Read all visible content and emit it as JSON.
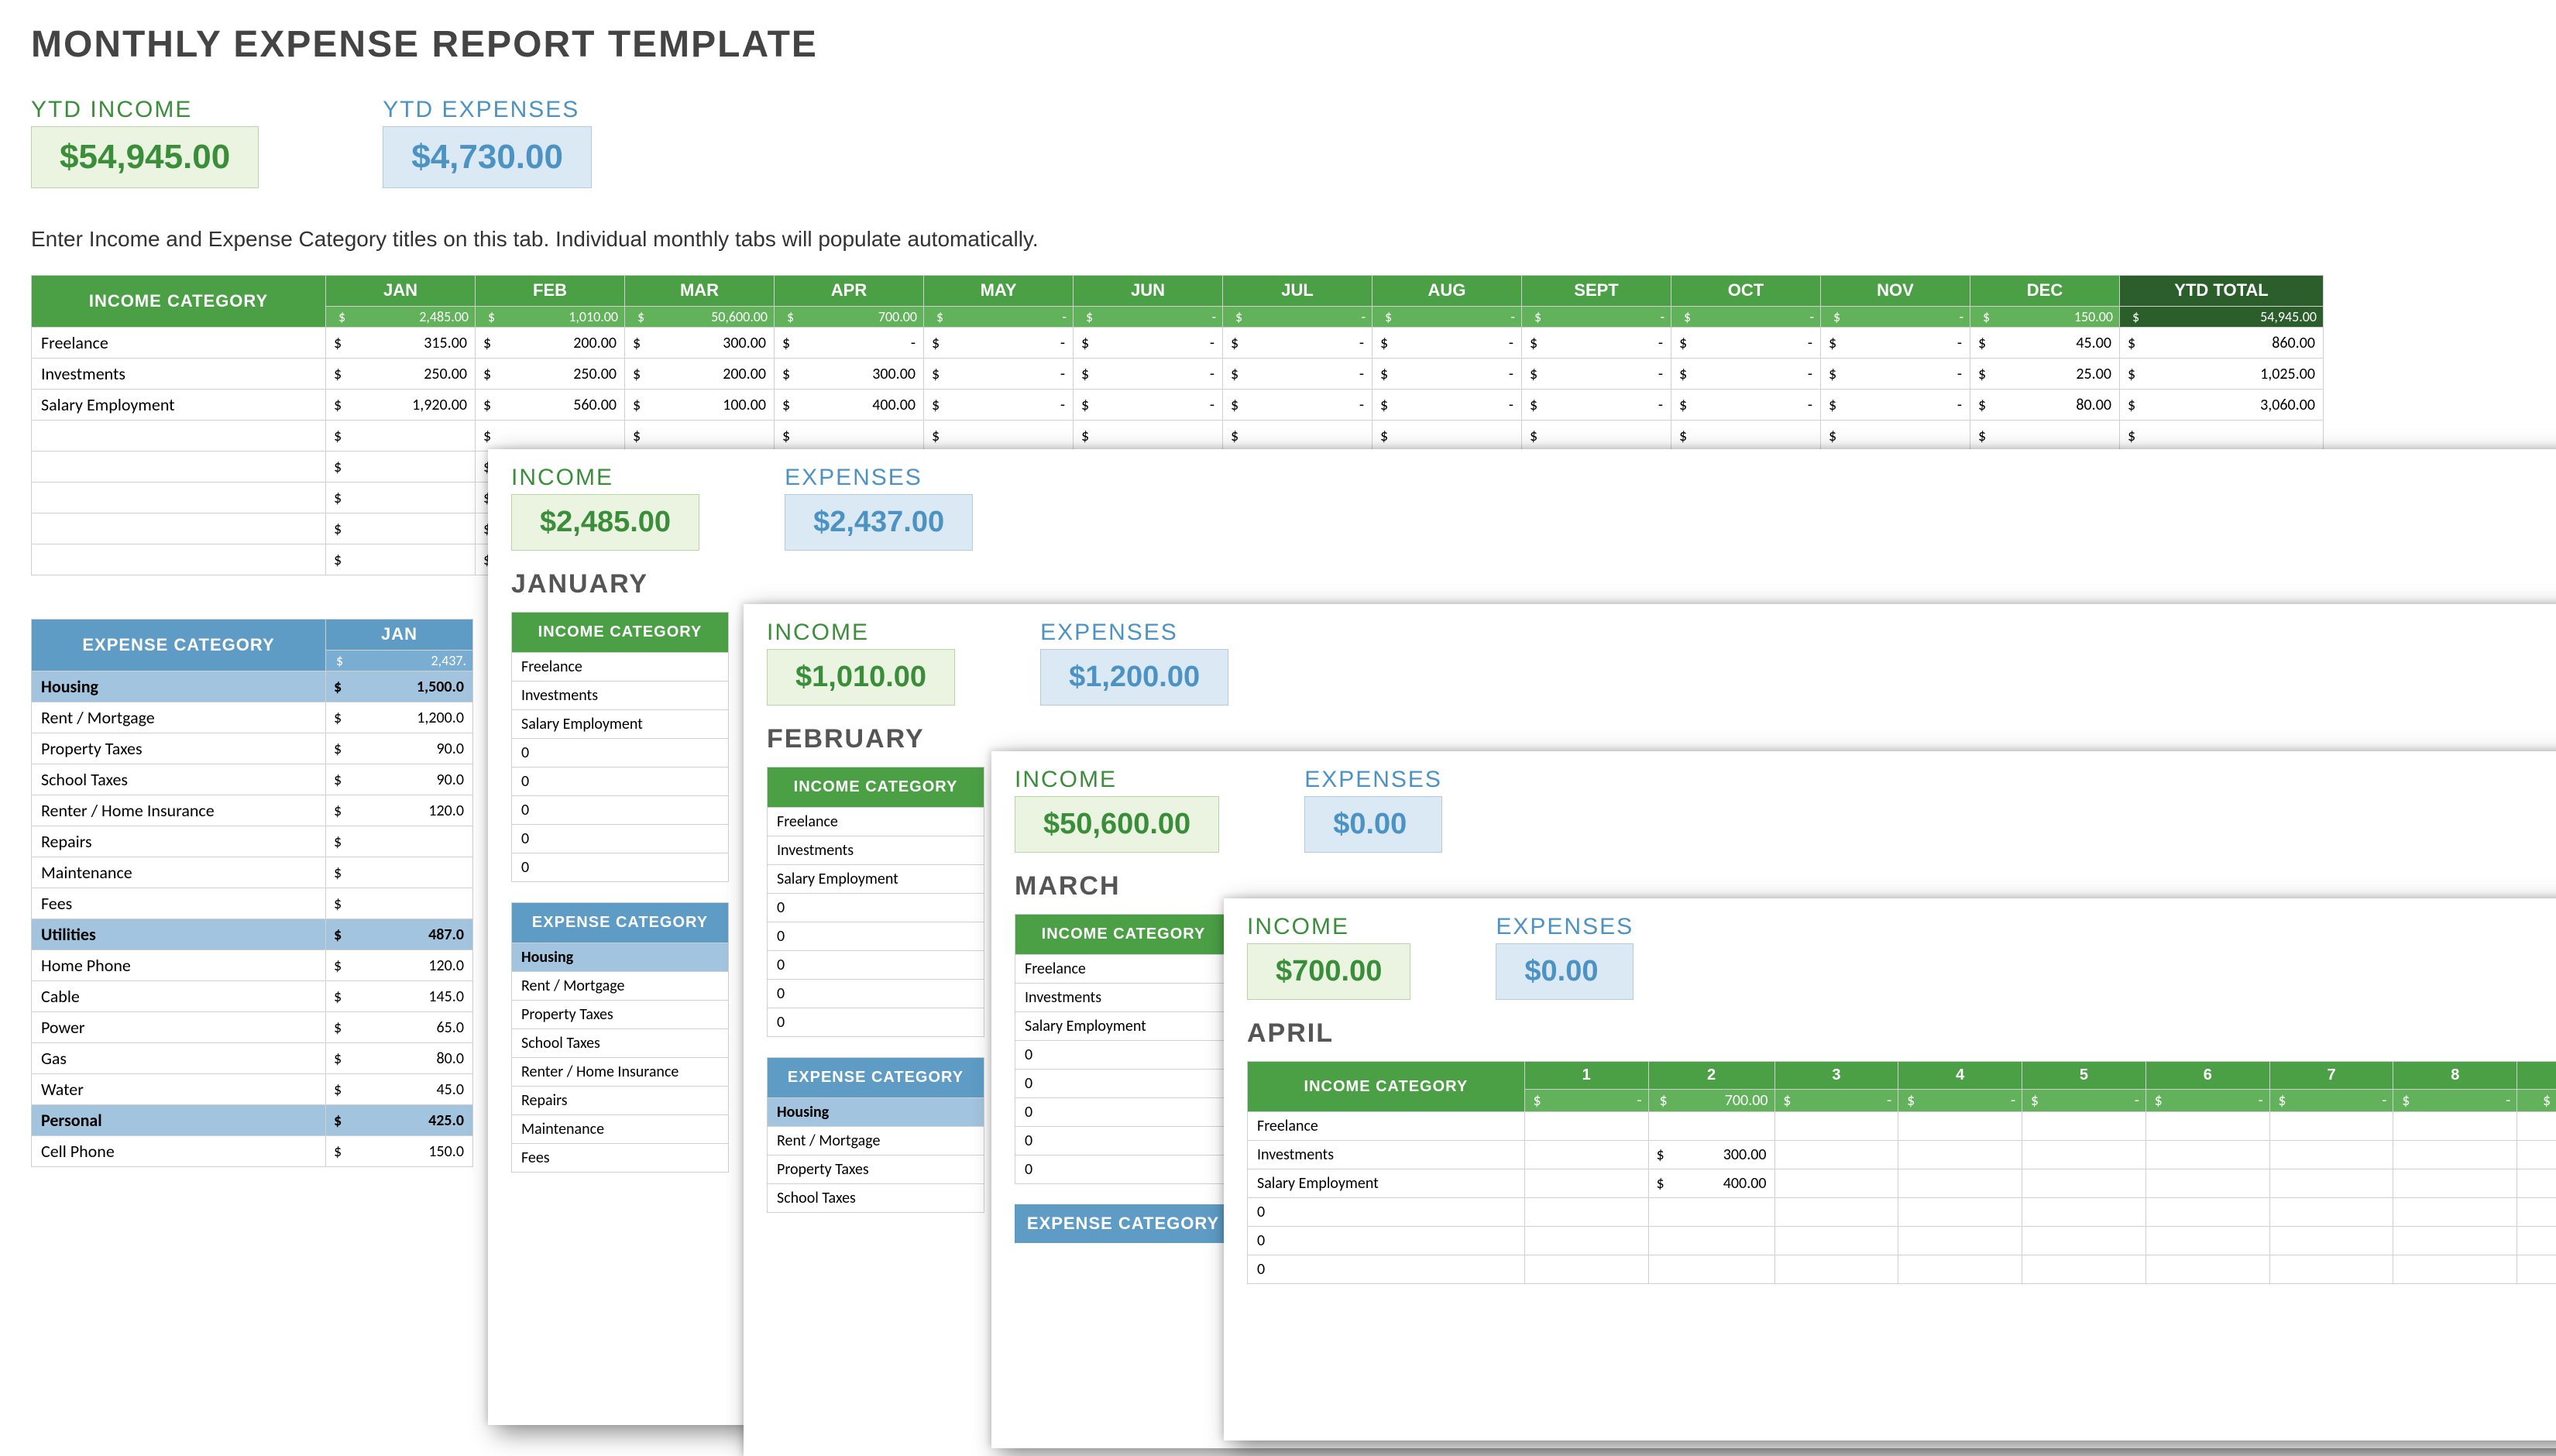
{
  "title": "MONTHLY EXPENSE REPORT TEMPLATE",
  "ytd": {
    "income_label": "YTD INCOME",
    "income_value": "$54,945.00",
    "expense_label": "YTD EXPENSES",
    "expense_value": "$4,730.00"
  },
  "instructions": "Enter Income and Expense Category titles on this tab.  Individual monthly tabs will populate automatically.",
  "months": [
    "JAN",
    "FEB",
    "MAR",
    "APR",
    "MAY",
    "JUN",
    "JUL",
    "AUG",
    "SEPT",
    "OCT",
    "NOV",
    "DEC"
  ],
  "ytd_total_label": "YTD TOTAL",
  "income_category_label": "INCOME CATEGORY",
  "expense_category_label": "EXPENSE CATEGORY",
  "income_month_totals": [
    "2,485.00",
    "1,010.00",
    "50,600.00",
    "700.00",
    "-",
    "-",
    "-",
    "-",
    "-",
    "-",
    "-",
    "150.00"
  ],
  "income_ytd_total": "54,945.00",
  "income_rows": [
    {
      "cat": "Freelance",
      "vals": [
        "315.00",
        "200.00",
        "300.00",
        "-",
        "-",
        "-",
        "-",
        "-",
        "-",
        "-",
        "-",
        "45.00"
      ],
      "ytd": "860.00"
    },
    {
      "cat": "Investments",
      "vals": [
        "250.00",
        "250.00",
        "200.00",
        "300.00",
        "-",
        "-",
        "-",
        "-",
        "-",
        "-",
        "-",
        "25.00"
      ],
      "ytd": "1,025.00"
    },
    {
      "cat": "Salary Employment",
      "vals": [
        "1,920.00",
        "560.00",
        "100.00",
        "400.00",
        "-",
        "-",
        "-",
        "-",
        "-",
        "-",
        "-",
        "80.00"
      ],
      "ytd": "3,060.00"
    }
  ],
  "blank_income_rows": 5,
  "exp_jan_label": "JAN",
  "exp_jan_total": "2,437.",
  "expense_rows": [
    {
      "cat": "Housing",
      "jan": "1,500.0",
      "group": true
    },
    {
      "cat": "Rent / Mortgage",
      "jan": "1,200.0"
    },
    {
      "cat": "Property Taxes",
      "jan": "90.0"
    },
    {
      "cat": "School Taxes",
      "jan": "90.0"
    },
    {
      "cat": "Renter / Home Insurance",
      "jan": "120.0"
    },
    {
      "cat": "Repairs",
      "jan": ""
    },
    {
      "cat": "Maintenance",
      "jan": ""
    },
    {
      "cat": "Fees",
      "jan": ""
    },
    {
      "cat": "Utilities",
      "jan": "487.0",
      "group": true
    },
    {
      "cat": "Home Phone",
      "jan": "120.0"
    },
    {
      "cat": "Cable",
      "jan": "145.0"
    },
    {
      "cat": "Power",
      "jan": "65.0"
    },
    {
      "cat": "Gas",
      "jan": "80.0"
    },
    {
      "cat": "Water",
      "jan": "45.0"
    },
    {
      "cat": "Personal",
      "jan": "425.0",
      "group": true
    },
    {
      "cat": "Cell Phone",
      "jan": "150.0"
    }
  ],
  "panels": {
    "jan": {
      "income_label": "INCOME",
      "income_value": "$2,485.00",
      "expense_label": "EXPENSES",
      "expense_value": "$2,437.00",
      "month": "JANUARY",
      "income_list": [
        "Freelance",
        "Investments",
        "Salary Employment",
        "0",
        "0",
        "0",
        "0",
        "0"
      ],
      "exp_group": "Housing",
      "exp_list": [
        "Rent / Mortgage",
        "Property Taxes",
        "School Taxes",
        "Renter / Home Insurance",
        "Repairs",
        "Maintenance",
        "Fees"
      ]
    },
    "feb": {
      "income_label": "INCOME",
      "income_value": "$1,010.00",
      "expense_label": "EXPENSES",
      "expense_value": "$1,200.00",
      "month": "FEBRUARY",
      "income_list": [
        "Freelance",
        "Investments",
        "Salary Employment",
        "0",
        "0",
        "0",
        "0",
        "0"
      ],
      "exp_group": "Housing",
      "exp_list": [
        "Rent / Mortgage",
        "Property Taxes",
        "School Taxes"
      ]
    },
    "mar": {
      "income_label": "INCOME",
      "income_value": "$50,600.00",
      "expense_label": "EXPENSES",
      "expense_value": "$0.00",
      "month": "MARCH",
      "income_list": [
        "Freelance",
        "Investments",
        "Salary Employment",
        "0",
        "0",
        "0",
        "0",
        "0"
      ]
    },
    "apr": {
      "income_label": "INCOME",
      "income_value": "$700.00",
      "expense_label": "EXPENSES",
      "expense_value": "$0.00",
      "month": "APRIL",
      "day_totals": [
        "-",
        "700.00",
        "-",
        "-",
        "-",
        "-",
        "-",
        "-"
      ],
      "rows": [
        {
          "cat": "Freelance",
          "d2": ""
        },
        {
          "cat": "Investments",
          "d2": "300.00"
        },
        {
          "cat": "Salary Employment",
          "d2": "400.00"
        },
        {
          "cat": "0"
        },
        {
          "cat": "0"
        },
        {
          "cat": "0"
        }
      ]
    }
  }
}
